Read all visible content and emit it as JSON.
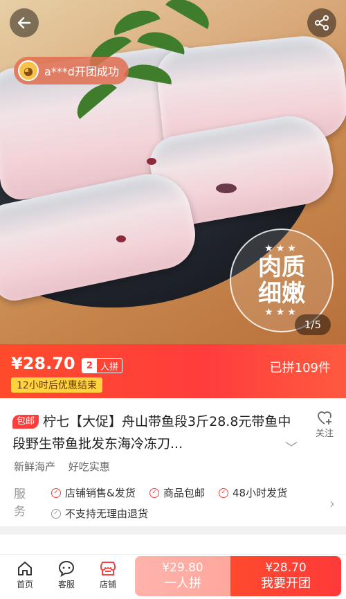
{
  "hero": {
    "notice_text": "a***d开团成功",
    "seal_line1": "肉质",
    "seal_line2": "细嫩",
    "pager": "1/5"
  },
  "price_bar": {
    "price": "¥28.70",
    "group_size": "2",
    "group_label": "人拼",
    "deadline": "12小时后优惠结束",
    "sold": "已拼109件"
  },
  "product": {
    "mail_tag": "包邮",
    "title": "柠七【大促】舟山带鱼段3斤28.8元带鱼中段野生带鱼批发东海冷冻刀...",
    "follow_label": "关注",
    "tags": [
      "新鲜海产",
      "好吃实惠"
    ]
  },
  "services": {
    "label": "服务",
    "items": [
      "店铺销售&发货",
      "商品包邮",
      "48小时发货"
    ],
    "excluded": "不支持无理由退货"
  },
  "bottom_nav": {
    "home": "首页",
    "service": "客服",
    "shop": "店铺"
  },
  "buy": {
    "single_price": "¥29.80",
    "single_label": "一人拼",
    "group_price": "¥28.70",
    "group_label": "我要开团"
  },
  "colors": {
    "accent": "#ff3d3d",
    "deadline_bg": "#ffd23f",
    "single_btn": "#ffaaa0"
  },
  "icons": [
    "back-arrow-icon",
    "share-icon",
    "heart-icon",
    "chevron-down-icon",
    "chevron-right-icon",
    "home-icon",
    "service-icon",
    "shop-icon",
    "check-circle-icon"
  ]
}
